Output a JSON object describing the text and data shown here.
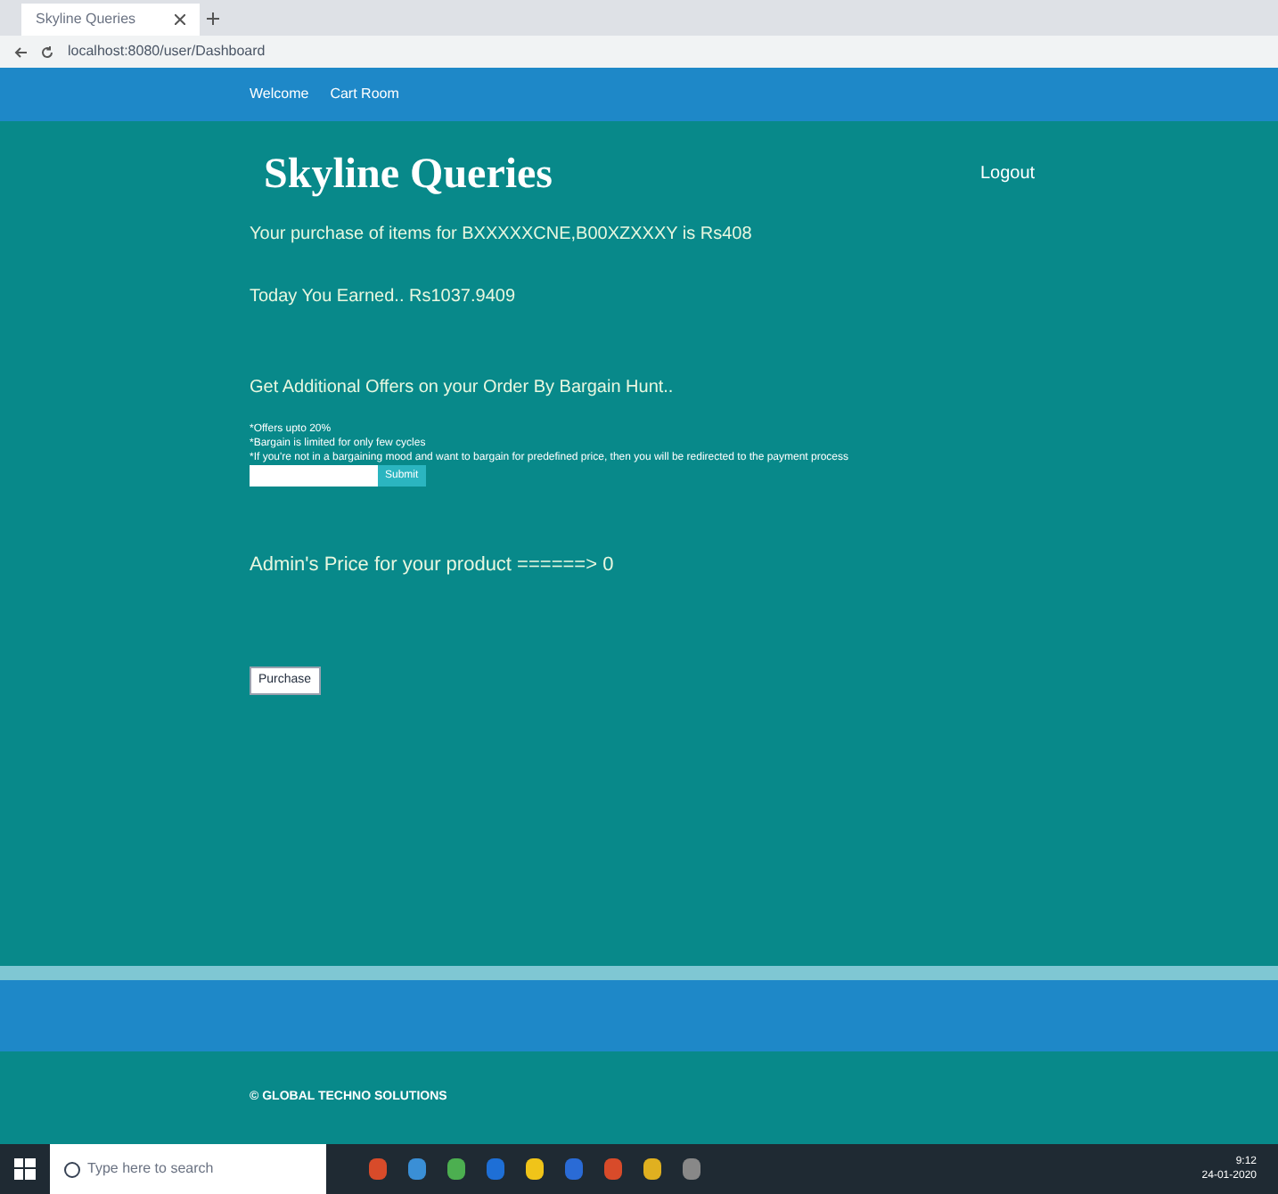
{
  "browser": {
    "tab_title": "Skyline Queries",
    "url": "localhost:8080/user/Dashboard"
  },
  "nav": {
    "links": [
      "Welcome",
      "Cart Room"
    ]
  },
  "page": {
    "title": "Skyline Queries",
    "logout": "Logout",
    "purchase": "Your purchase of items for BXXXXXCNE,B00XZXXXY is  Rs408",
    "earned": "Today You Earned.. Rs1037.9409",
    "offer_heading": "Get Additional Offers on your Order By Bargain Hunt..",
    "notes": [
      "*Offers upto 20%",
      "*Bargain is limited for only few cycles",
      "*If you're not in a bargaining mood and want to bargain for predefined price, then you will be redirected to the payment process"
    ],
    "bargain_button": "Submit",
    "admin_price": "Admin's Price for your product ======> 0",
    "purchase_button": "Purchase"
  },
  "footer": {
    "copyright": "© GLOBAL TECHNO SOLUTIONS"
  },
  "taskbar": {
    "search_placeholder": "Type here to search",
    "time": "9:12",
    "date": "24-01-2020"
  }
}
